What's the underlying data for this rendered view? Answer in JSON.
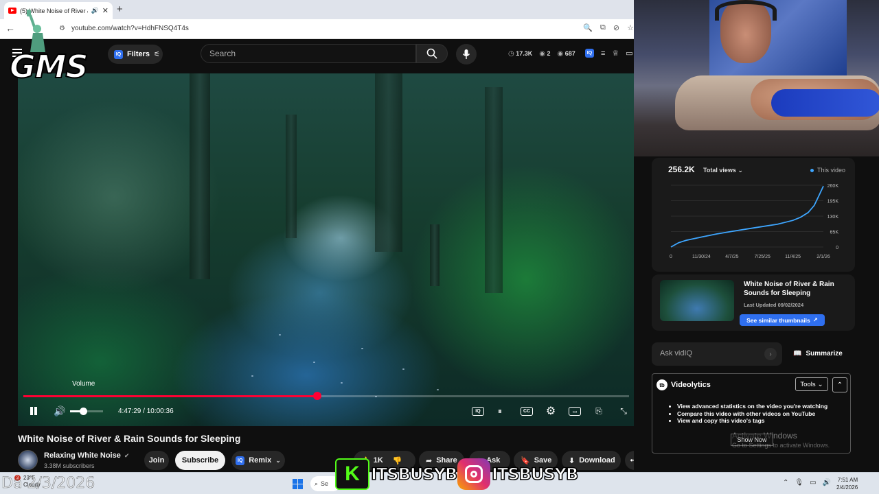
{
  "browser": {
    "tab_title": "(5) White Noise of River &",
    "new_tab": "+",
    "url": "youtube.com/watch?v=HdhFNSQ4T4s"
  },
  "youtube": {
    "filters_label": "Filters",
    "search_placeholder": "Search",
    "stats": {
      "views": "17.3K",
      "watching": "2",
      "likes": "687"
    }
  },
  "overlay": {
    "logo_text": "GMS",
    "kick_letter": "K",
    "kick_handle": "ITSBUSYB",
    "insta_handle": "ITSBUSYB",
    "date_text": "Da 2/3/2026"
  },
  "player": {
    "volume_tooltip": "Volume",
    "current_time": "4:47:29",
    "duration": "10:00:36",
    "time_display": "4:47:29 / 10:00:36",
    "progress_fraction": 0.485,
    "volume_fraction": 0.4
  },
  "video": {
    "title": "White Noise of River & Rain Sounds for Sleeping",
    "channel_name": "Relaxing White Noise",
    "subscribers": "3.38M subscribers",
    "join_label": "Join",
    "subscribe_label": "Subscribe",
    "remix_label": "Remix",
    "likes": "1K",
    "share_label": "Share",
    "ask_label": "Ask",
    "save_label": "Save",
    "download_label": "Download"
  },
  "vidiq": {
    "total_views": "256.2K",
    "total_views_label": "Total views",
    "legend_label": "This video",
    "thumb_title": "White Noise of River & Rain Sounds for Sleeping",
    "last_updated": "Last Updated 09/02/2024",
    "similar_label": "See similar thumbnails",
    "ask_placeholder": "Ask vidIQ",
    "summarize_label": "Summarize"
  },
  "videolytics": {
    "title": "Videolytics",
    "tools_label": "Tools",
    "items": [
      "View advanced statistics on the video you're watching",
      "Compare this video with other videos on YouTube",
      "View and copy this video's tags"
    ],
    "show_now": "Show Now",
    "activate_title": "Activate Windows",
    "activate_sub": "Go to Settings to activate Windows."
  },
  "taskbar": {
    "weather_badge": "3",
    "temperature": "23°F",
    "weather_desc": "Cloudy",
    "search_label": "Se",
    "time": "7:51 AM",
    "date": "2/4/2026"
  },
  "chart_data": {
    "type": "line",
    "title": "",
    "x_tick_labels": [
      "0",
      "11/30/24",
      "4/7/25",
      "7/25/25",
      "11/4/25",
      "2/1/26"
    ],
    "y_tick_labels": [
      "0",
      "65K",
      "130K",
      "195K",
      "260K"
    ],
    "ylim": [
      0,
      260000
    ],
    "series": [
      {
        "name": "This video",
        "color": "#3ea6ff",
        "x": [
          0,
          0.05,
          0.1,
          0.2,
          0.3,
          0.4,
          0.5,
          0.6,
          0.7,
          0.8,
          0.85,
          0.9,
          0.94,
          0.97,
          1.0
        ],
        "y": [
          0,
          18000,
          28000,
          42000,
          55000,
          66000,
          76000,
          86000,
          96000,
          112000,
          125000,
          145000,
          175000,
          215000,
          256200
        ]
      }
    ],
    "grid": true
  }
}
